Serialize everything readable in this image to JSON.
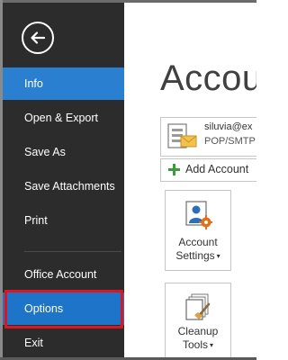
{
  "nav": {
    "back_icon": "back-arrow-icon",
    "items": [
      {
        "label": "Info"
      },
      {
        "label": "Open & Export"
      },
      {
        "label": "Save As"
      },
      {
        "label": "Save Attachments"
      },
      {
        "label": "Print"
      },
      {
        "label": "Office Account"
      },
      {
        "label": "Options"
      },
      {
        "label": "Exit"
      }
    ]
  },
  "main": {
    "title": "Accou",
    "account": {
      "email": "siluvia@ex",
      "type": "POP/SMTP"
    },
    "add_account_label": "Add Account",
    "tiles": [
      {
        "line1": "Account",
        "line2": "Settings"
      },
      {
        "line1": "Cleanup",
        "line2": "Tools"
      }
    ]
  },
  "colors": {
    "nav_bg": "#2c2c2c",
    "active_blue": "#2b7fd1",
    "highlight_red": "#e0141d"
  }
}
